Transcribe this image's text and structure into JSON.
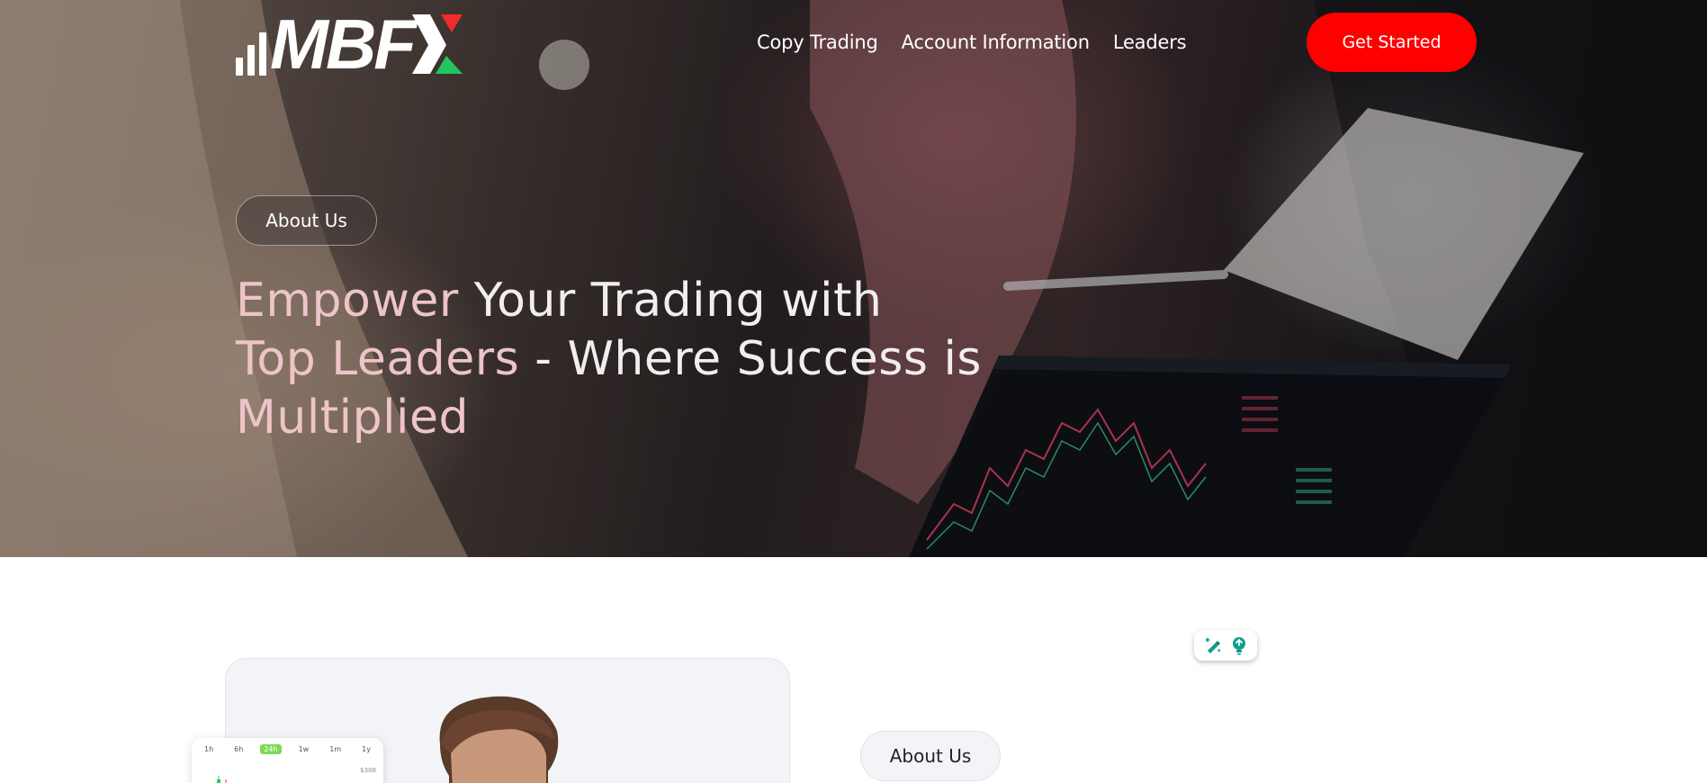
{
  "header": {
    "logo_text": "MBF",
    "nav": [
      {
        "label": "Copy Trading"
      },
      {
        "label": "Account Information"
      },
      {
        "label": "Leaders"
      }
    ],
    "cta_label": "Get Started"
  },
  "hero": {
    "badge": "About Us",
    "headline_parts": [
      {
        "text": "Empower ",
        "tone": "pink"
      },
      {
        "text": "Your Trading with",
        "tone": "white"
      },
      {
        "text": "Top Leaders",
        "tone": "pink"
      },
      {
        "text": " - Where Success is",
        "tone": "white"
      },
      {
        "text": "Multiplied",
        "tone": "pink"
      }
    ]
  },
  "about": {
    "badge": "About Us",
    "chart_card": {
      "tabs": [
        "1h",
        "6h",
        "24h",
        "1w",
        "1m",
        "1y"
      ],
      "active_tab": "24h",
      "price_label": "$308"
    }
  },
  "floating_toolbar": {
    "icons": [
      "magic-pen-icon",
      "lightbulb-icon"
    ]
  },
  "colors": {
    "brand_red": "#ff0000",
    "headline_pink": "#eec4c8",
    "logo_green": "#22c55e",
    "logo_red": "#ef2b2b",
    "tab_green": "#7ed957",
    "toolbar_teal": "#0f9d8a"
  }
}
